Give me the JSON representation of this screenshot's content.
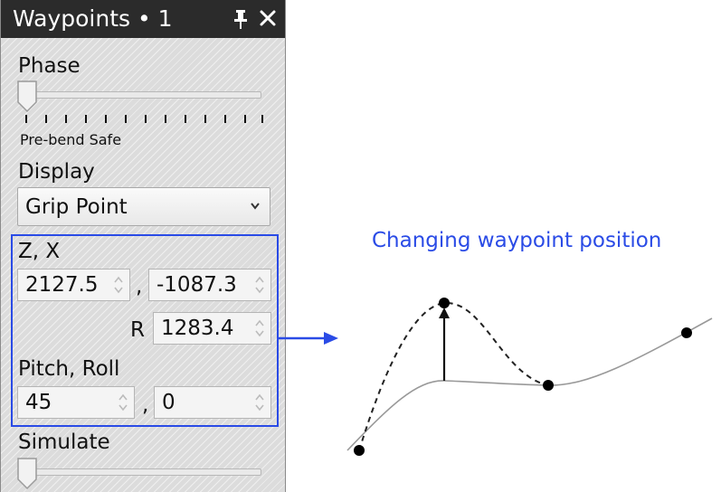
{
  "window": {
    "title": "Waypoints • 1",
    "pin_icon": "pin-icon",
    "close_icon": "close-icon"
  },
  "phase": {
    "label": "Phase",
    "value_label": "Pre-bend Safe",
    "position": 0
  },
  "display": {
    "label": "Display",
    "selected": "Grip Point"
  },
  "position": {
    "zx_label": "Z, X",
    "z": "2127.5",
    "x": "-1087.3",
    "comma": ",",
    "r_label": "R",
    "r": "1283.4",
    "pitch_roll_label": "Pitch, Roll",
    "pitch": "45",
    "roll": "0"
  },
  "simulate": {
    "label": "Simulate",
    "position": 0
  },
  "illustration": {
    "caption": "Changing waypoint position"
  },
  "colors": {
    "accent": "#2a4be6",
    "titlebar": "#2b2b2b"
  }
}
